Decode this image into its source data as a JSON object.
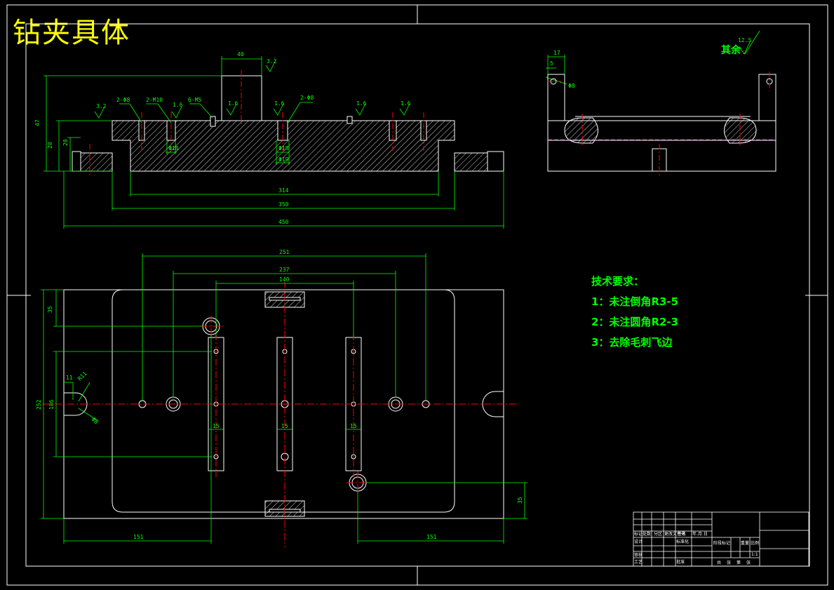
{
  "title": "钻夹具体",
  "roughness_note": {
    "label": "其余",
    "value": "12.5"
  },
  "technical_requirements": {
    "heading": "技术要求：",
    "items": [
      "1：未注倒角R3-5",
      "2：未注圆角R2-3",
      "3：去除毛刺飞边"
    ]
  },
  "dimensions": {
    "front": {
      "top_width": "40",
      "overall_height": "47",
      "body_height": "28",
      "flange_height": "20",
      "inner_width": "314",
      "body_width": "350",
      "overall_width": "450",
      "holes_left": "2-Φ8",
      "holes_mid": "2-M10",
      "holes_right": "2-Φ8",
      "holes_6": "6-M5",
      "dia_a": "Φ18",
      "dia_b": "Φ18",
      "dia_c": "Φ19",
      "roughness": [
        "3.2",
        "3.2",
        "1.6",
        "1.6",
        "1.6",
        "1.6",
        "1.6"
      ]
    },
    "side": {
      "width": "17",
      "offset": "5",
      "hole": "Φ8"
    },
    "plan": {
      "span_outer": "251",
      "span_mid": "237",
      "span_inner": "140",
      "top_offset": "35",
      "height_inner": "186",
      "height_overall": "252",
      "slot_width": [
        "15",
        "15",
        "15"
      ],
      "left_offset": "11",
      "radius": "R11",
      "left_dia": "Φ8",
      "bottom_left": "151",
      "bottom_right": "151",
      "bottom_offset": "35"
    }
  },
  "title_block": {
    "cells": [
      "标记",
      "处数",
      "分区",
      "更改文件号",
      "签名",
      "年.月.日",
      "设计",
      "标准化",
      "阶段标记",
      "重量",
      "比例",
      "审核",
      "工艺",
      "批准",
      "1:1",
      "共",
      "张",
      "第",
      "张"
    ]
  }
}
